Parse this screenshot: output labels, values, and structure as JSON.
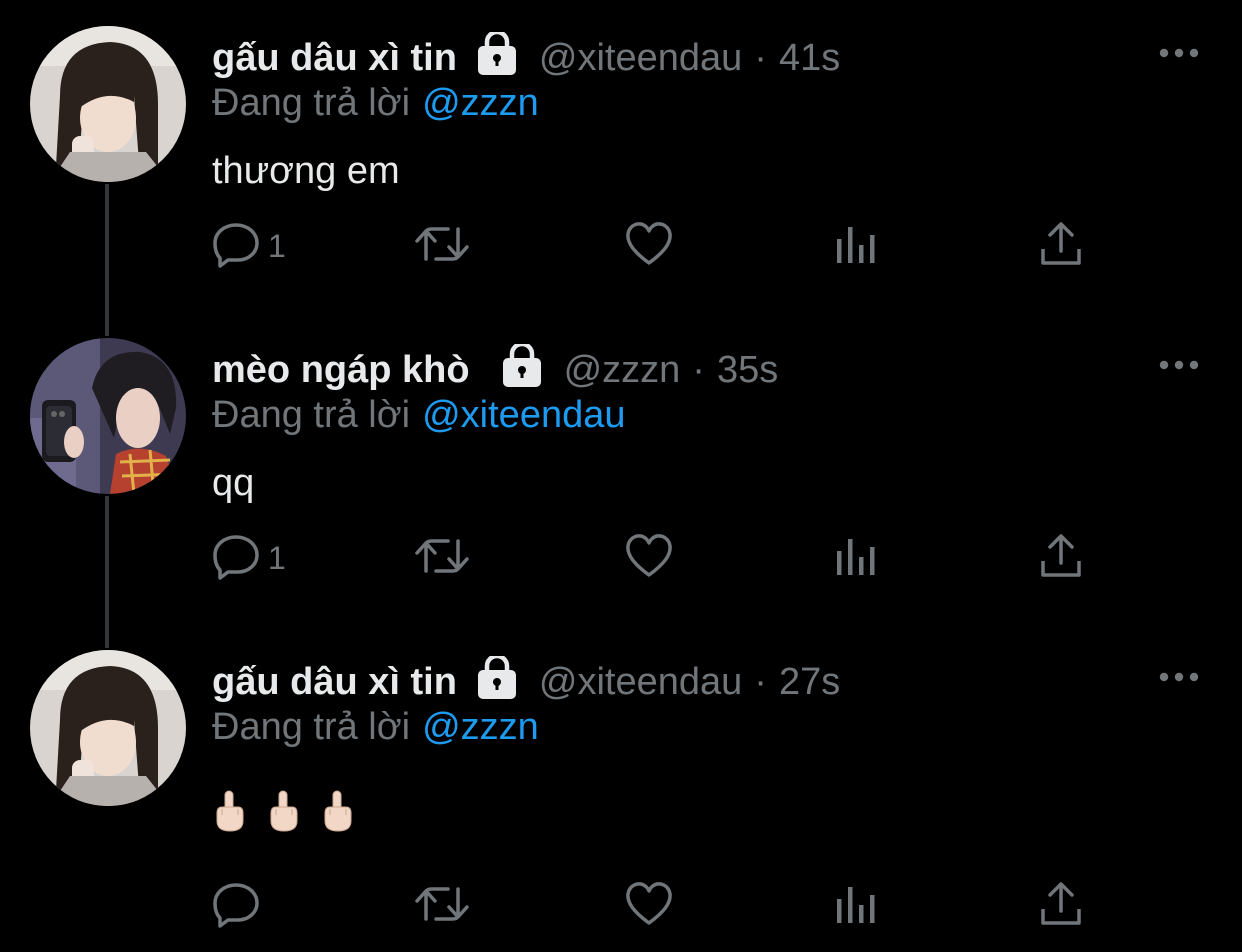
{
  "tweets": [
    {
      "display_name": "gấu dâu xì tin",
      "handle": "@xiteendau",
      "separator": "·",
      "time": "41s",
      "replying_prefix": "Đang trả lời",
      "replying_to": "@zzzn",
      "text": "thương em",
      "reply_count": "1",
      "avatar": "avatar-xiteendau"
    },
    {
      "display_name": "mèo ngáp khò",
      "handle": "@zzzn",
      "separator": "·",
      "time": "35s",
      "replying_prefix": "Đang trả lời",
      "replying_to": "@xiteendau",
      "text": "qq",
      "reply_count": "1",
      "avatar": "avatar-zzzn"
    },
    {
      "display_name": "gấu dâu xì tin",
      "handle": "@xiteendau",
      "separator": "·",
      "time": "27s",
      "replying_prefix": "Đang trả lời",
      "replying_to": "@zzzn",
      "text": "",
      "emoji": "middle-finger-emoji ×3",
      "reply_count": "",
      "avatar": "avatar-xiteendau"
    }
  ],
  "icons": {
    "reply": "reply-icon",
    "retweet": "retweet-icon",
    "like": "like-icon",
    "views": "views-icon",
    "share": "share-icon",
    "more": "more-icon",
    "lock": "lock-icon"
  },
  "colors": {
    "background": "#000000",
    "text": "#e7e9ea",
    "muted": "#71767b",
    "link": "#1d9bf0",
    "thread_line": "#333639"
  }
}
